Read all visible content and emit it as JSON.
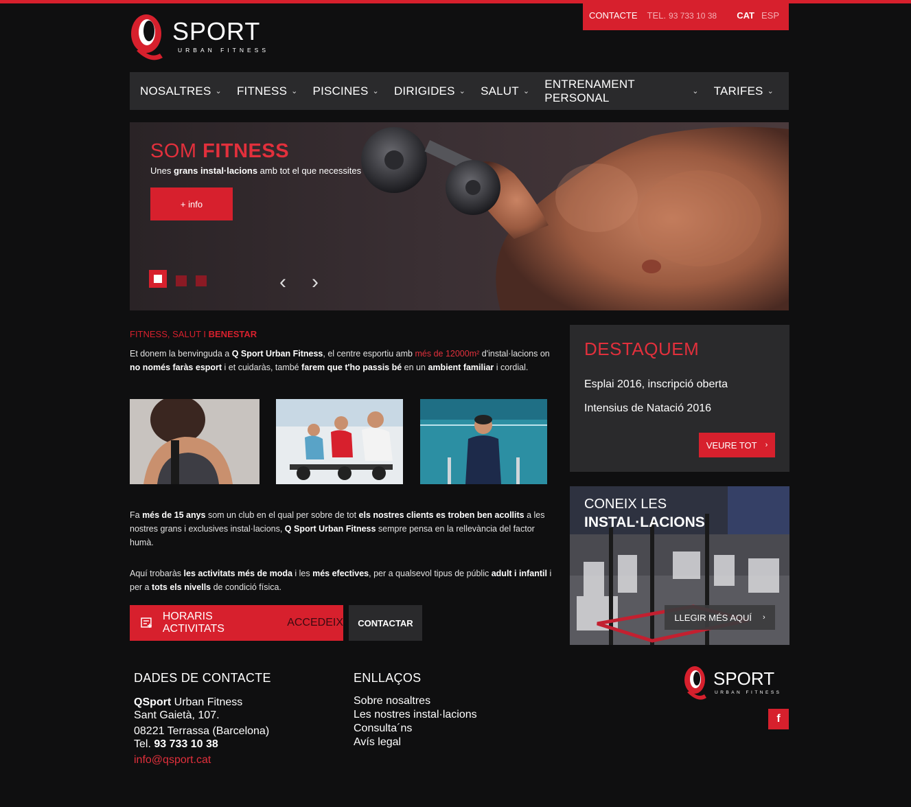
{
  "header": {
    "logo_word": "SPORT",
    "logo_tagline": "URBAN FITNESS",
    "contact_label": "CONTACTE",
    "tel_label": "TEL.",
    "tel_number": "93 733 10 38",
    "lang_active": "CAT",
    "lang_other": "ESP"
  },
  "nav": {
    "items": [
      "NOSALTRES",
      "FITNESS",
      "PISCINES",
      "DIRIGIDES",
      "SALUT",
      "ENTRENAMENT PERSONAL",
      "TARIFES"
    ]
  },
  "hero": {
    "title_light": "SOM ",
    "title_bold": "FITNESS",
    "subtitle_pre": "Unes ",
    "subtitle_bold": "grans instal·lacions",
    "subtitle_post": " amb tot el que necessites",
    "button": "+ info"
  },
  "intro": {
    "kicker_light": "FITNESS, SALUT I ",
    "kicker_bold": "BENESTAR",
    "p1": [
      {
        "t": "Et donem la benvinguda a ",
        "s": ""
      },
      {
        "t": "Q Sport Urban Fitness",
        "s": "b"
      },
      {
        "t": ", el centre esportiu amb ",
        "s": ""
      },
      {
        "t": "més de 12000m²",
        "s": "red"
      },
      {
        "t": " d'instal·lacions on ",
        "s": ""
      },
      {
        "t": "no només faràs esport",
        "s": "b"
      },
      {
        "t": " i et cuidaràs, també ",
        "s": ""
      },
      {
        "t": "farem que t'ho passis bé",
        "s": "b"
      },
      {
        "t": " en un ",
        "s": ""
      },
      {
        "t": "ambient familiar",
        "s": "b"
      },
      {
        "t": " i cordial.",
        "s": ""
      }
    ],
    "p2": [
      {
        "t": "Fa ",
        "s": ""
      },
      {
        "t": "més de 15 anys",
        "s": "b"
      },
      {
        "t": " som un club en el qual per sobre de tot ",
        "s": ""
      },
      {
        "t": "els nostres clients es troben ben acollits",
        "s": "b"
      },
      {
        "t": " a les nostres grans i exclusives instal·lacions, ",
        "s": ""
      },
      {
        "t": "Q Sport Urban Fitness",
        "s": "b"
      },
      {
        "t": " sempre pensa en la rellevància del factor humà.",
        "s": ""
      }
    ],
    "p3": [
      {
        "t": "Aquí trobaràs ",
        "s": ""
      },
      {
        "t": "les activitats més de moda",
        "s": "b"
      },
      {
        "t": " i les ",
        "s": ""
      },
      {
        "t": "més efectives",
        "s": "b"
      },
      {
        "t": ", per a qualsevol tipus de públic ",
        "s": ""
      },
      {
        "t": "adult i infantil",
        "s": "b"
      },
      {
        "t": " i per a ",
        "s": ""
      },
      {
        "t": "tots els nivells",
        "s": "b"
      },
      {
        "t": " de condició física.",
        "s": ""
      }
    ],
    "cta_schedule": "HORARIS ACTIVITATS",
    "cta_schedule_accent": "ACCEDEIX",
    "cta_contact": "CONTACTAR"
  },
  "featured": {
    "title": "DESTAQUEM",
    "items": [
      "Esplai 2016, inscripció oberta",
      "Intensius de Natació 2016"
    ],
    "button": "VEURE TOT"
  },
  "facilities": {
    "title_light": "CONEIX LES",
    "title_bold": "INSTAL·LACIONS",
    "button": "LLEGIR MÉS AQUÍ"
  },
  "footer": {
    "contact_title": "DADES DE CONTACTE",
    "company_bold": "QSport",
    "company_rest": " Urban Fitness",
    "address1": "Sant Gaietà, 107.",
    "address2": "08221 Terrassa (Barcelona)",
    "tel_label": "Tel. ",
    "tel_number": "93 733 10 38",
    "email": "info@qsport.cat",
    "links_title": "ENLLAÇOS",
    "links": [
      "Sobre nosaltres",
      "Les nostres instal·lacions",
      "Consulta´ns",
      "Avís legal"
    ],
    "facebook": "f"
  },
  "colors": {
    "brand_red": "#d7202d",
    "background": "#0f0f10",
    "panel": "#2a2a2c"
  }
}
